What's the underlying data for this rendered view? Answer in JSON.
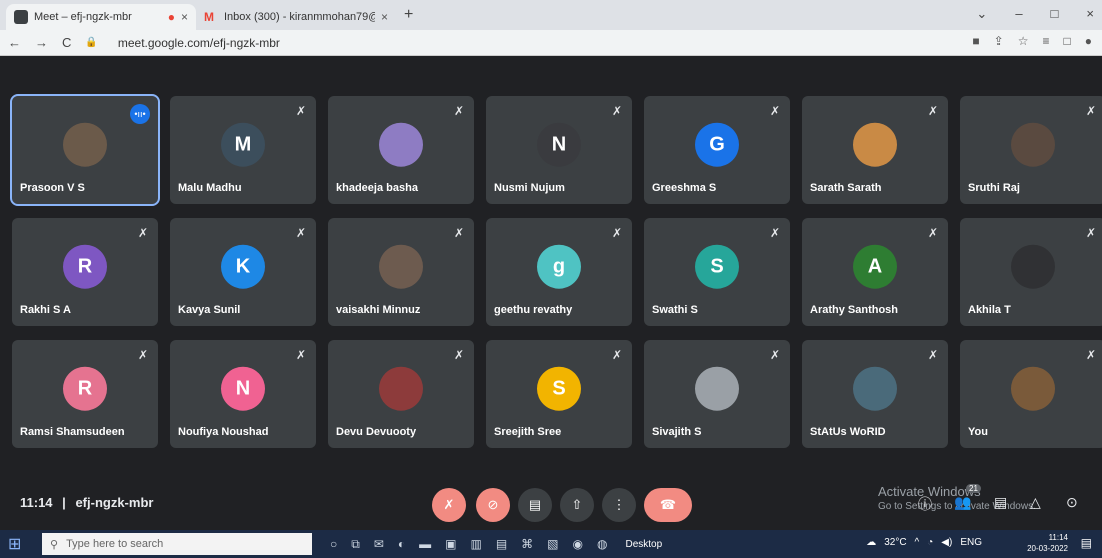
{
  "browser": {
    "tabs": [
      {
        "title": "Meet – efj-ngzk-mbr",
        "close": "×",
        "color": "#3c4043"
      },
      {
        "title": "Inbox (300) - kiranmmohan79@",
        "close": "×",
        "color": "#ea4335"
      }
    ],
    "new_tab": "+",
    "window_controls": [
      "⌄",
      "–",
      "□",
      "×"
    ],
    "url": "meet.google.com/efj-ngzk-mbr",
    "nav": {
      "back": "←",
      "forward": "→",
      "reload": "C"
    }
  },
  "participants": [
    {
      "name": "Prasoon V S",
      "initial": "",
      "color": "#6b5a4a",
      "muted": false,
      "speaking": true
    },
    {
      "name": "Malu Madhu",
      "initial": "M",
      "color": "#3c4e5c",
      "muted": true,
      "speaking": false
    },
    {
      "name": "khadeeja basha",
      "initial": "",
      "color": "#8e7cc3",
      "muted": true,
      "speaking": false
    },
    {
      "name": "Nusmi Nujum",
      "initial": "N",
      "color": "#3a3b3f",
      "muted": true,
      "speaking": false
    },
    {
      "name": "Greeshma S",
      "initial": "G",
      "color": "#1a73e8",
      "muted": true,
      "speaking": false
    },
    {
      "name": "Sarath Sarath",
      "initial": "",
      "color": "#c98a45",
      "muted": true,
      "speaking": false
    },
    {
      "name": "Sruthi Raj",
      "initial": "",
      "color": "#5a4a40",
      "muted": true,
      "speaking": false
    },
    {
      "name": "Rakhi S A",
      "initial": "R",
      "color": "#7e57c2",
      "muted": true,
      "speaking": false
    },
    {
      "name": "Kavya Sunil",
      "initial": "K",
      "color": "#1e88e5",
      "muted": true,
      "speaking": false
    },
    {
      "name": "vaisakhi Minnuz",
      "initial": "",
      "color": "#6d5b4f",
      "muted": true,
      "speaking": false
    },
    {
      "name": "geethu revathy",
      "initial": "g",
      "color": "#4fc3c3",
      "muted": true,
      "speaking": false
    },
    {
      "name": "Swathi S",
      "initial": "S",
      "color": "#26a69a",
      "muted": true,
      "speaking": false
    },
    {
      "name": "Arathy Santhosh",
      "initial": "A",
      "color": "#2e7d32",
      "muted": true,
      "speaking": false
    },
    {
      "name": "Akhila T",
      "initial": "",
      "color": "#303134",
      "muted": true,
      "speaking": false
    },
    {
      "name": "Ramsi Shamsudeen",
      "initial": "R",
      "color": "#e57390",
      "muted": true,
      "speaking": false
    },
    {
      "name": "Noufiya Noushad",
      "initial": "N",
      "color": "#f06292",
      "muted": true,
      "speaking": false
    },
    {
      "name": "Devu Devuooty",
      "initial": "",
      "color": "#8d3b3b",
      "muted": true,
      "speaking": false
    },
    {
      "name": "Sreejith Sree",
      "initial": "S",
      "color": "#f2b400",
      "muted": true,
      "speaking": false
    },
    {
      "name": "Sivajith S",
      "initial": "",
      "color": "#9aa0a6",
      "muted": true,
      "speaking": false
    },
    {
      "name": "StAtUs WoRID",
      "initial": "",
      "color": "#4a6a7a",
      "muted": true,
      "speaking": false
    },
    {
      "name": "You",
      "initial": "",
      "color": "#7a5a3a",
      "muted": true,
      "speaking": false
    }
  ],
  "icons": {
    "mic_off": "✗",
    "speaking": "•ıı•"
  },
  "footer": {
    "time": "11:14",
    "separator": "|",
    "meeting_code": "efj-ngzk-mbr",
    "controls": [
      "✗",
      "⊘",
      "▤",
      "⇧",
      "⋮",
      "☎"
    ],
    "activate_line1": "Activate Windows",
    "activate_line2": "Go to Settings to activate Windows.",
    "participant_count": "21",
    "right_controls": [
      "ⓘ",
      "👥",
      "▤",
      "△",
      "⊙"
    ]
  },
  "taskbar": {
    "search_placeholder": "Type here to search",
    "desktop_label": "Desktop",
    "temperature": "32°C",
    "language": "ENG",
    "clock_time": "11:14",
    "clock_date": "20-03-2022"
  }
}
